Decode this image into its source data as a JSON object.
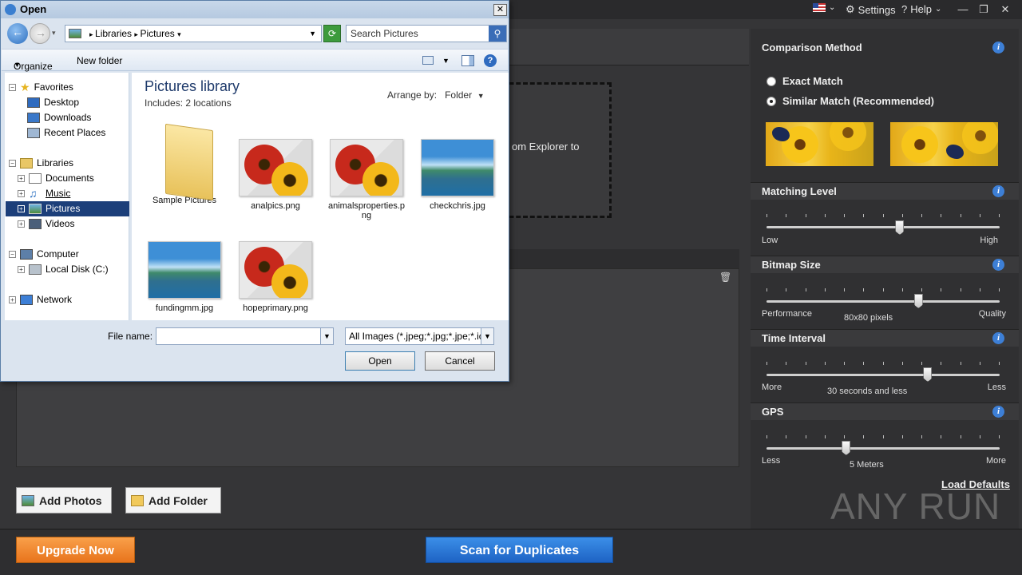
{
  "topbar": {
    "flag_icon": "us-flag-icon",
    "settings": "Settings",
    "help": "Help"
  },
  "dropzone": {
    "text": "om Explorer to"
  },
  "buttons": {
    "add_photos": "Add Photos",
    "add_folder": "Add Folder",
    "upgrade": "Upgrade Now",
    "scan": "Scan for Duplicates"
  },
  "sidebar": {
    "comparison_title": "Comparison Method",
    "exact": "Exact Match",
    "similar": "Similar Match (Recommended)",
    "selected_method": "similar",
    "matching_title": "Matching Level",
    "matching_low": "Low",
    "matching_high": "High",
    "matching_level": 0.57,
    "bitmap_title": "Bitmap Size",
    "bitmap_left": "Performance",
    "bitmap_mid": "80x80 pixels",
    "bitmap_right": "Quality",
    "bitmap_level": 0.65,
    "time_title": "Time Interval",
    "time_left": "More",
    "time_mid": "30 seconds and less",
    "time_right": "Less",
    "time_level": 0.69,
    "gps_title": "GPS",
    "gps_left": "Less",
    "gps_mid": "5 Meters",
    "gps_right": "More",
    "gps_level": 0.34,
    "load_defaults": "Load Defaults"
  },
  "watermark": "ANY RUN",
  "dialog": {
    "title": "Open",
    "breadcrumb": [
      "Libraries",
      "Pictures"
    ],
    "search_placeholder": "Search Pictures",
    "organize": "Organize",
    "new_folder": "New folder",
    "nav": {
      "favorites": "Favorites",
      "desktop": "Desktop",
      "downloads": "Downloads",
      "recent": "Recent Places",
      "libraries": "Libraries",
      "documents": "Documents",
      "music": "Music",
      "pictures": "Pictures",
      "videos": "Videos",
      "computer": "Computer",
      "local_disk": "Local Disk (C:)",
      "network": "Network"
    },
    "library_title": "Pictures library",
    "includes": "Includes:  2 locations",
    "arrange_label": "Arrange by:",
    "arrange_value": "Folder",
    "files": {
      "f1": "Sample Pictures",
      "f2": "analpics.png",
      "f3": "animalsproperties.png",
      "f4": "checkchris.jpg",
      "f5": "fundingmm.jpg",
      "f6": "hopeprimary.png"
    },
    "file_name_label": "File name:",
    "file_name_value": "",
    "filter": "All Images (*.jpeg;*.jpg;*.jpe;*.ic",
    "open": "Open",
    "cancel": "Cancel"
  }
}
